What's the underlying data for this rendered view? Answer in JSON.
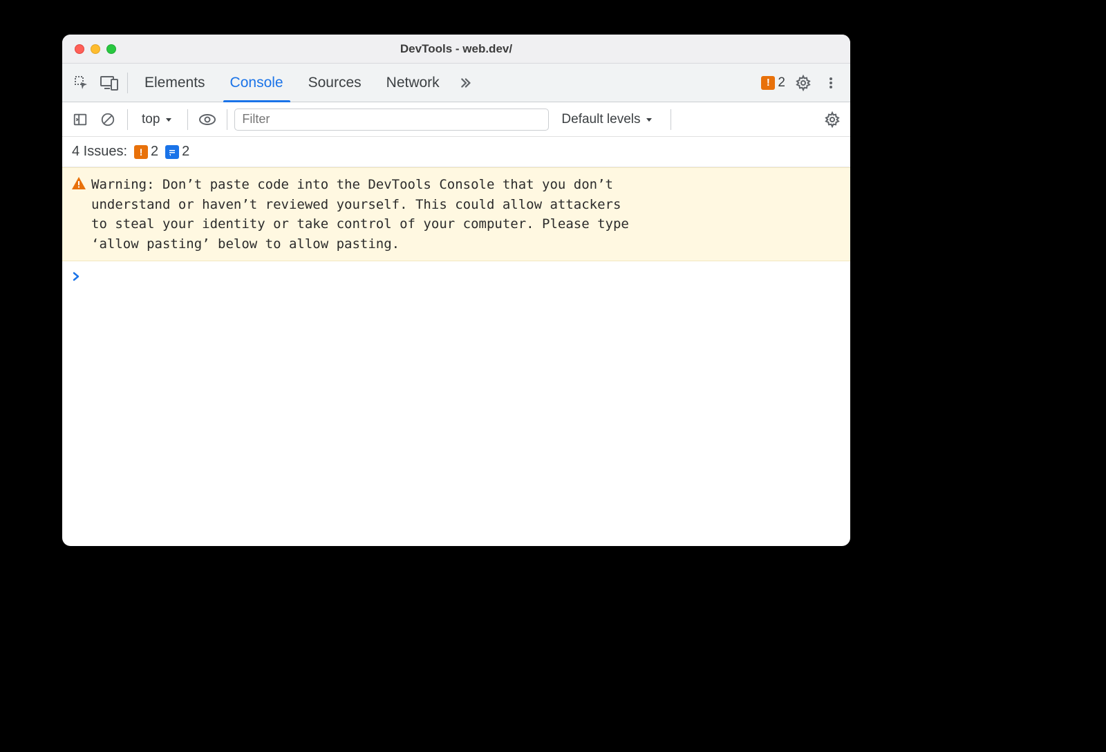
{
  "window": {
    "title": "DevTools - web.dev/"
  },
  "tabs": {
    "elements": "Elements",
    "console": "Console",
    "sources": "Sources",
    "network": "Network"
  },
  "topbar": {
    "error_count": "2"
  },
  "toolbar": {
    "context": "top",
    "filter_placeholder": "Filter",
    "levels": "Default levels"
  },
  "issues": {
    "label": "4 Issues:",
    "orange_count": "2",
    "blue_count": "2"
  },
  "warning": {
    "text": "Warning: Don’t paste code into the DevTools Console that you don’t\nunderstand or haven’t reviewed yourself. This could allow attackers\nto steal your identity or take control of your computer. Please type\n‘allow pasting’ below to allow pasting."
  }
}
